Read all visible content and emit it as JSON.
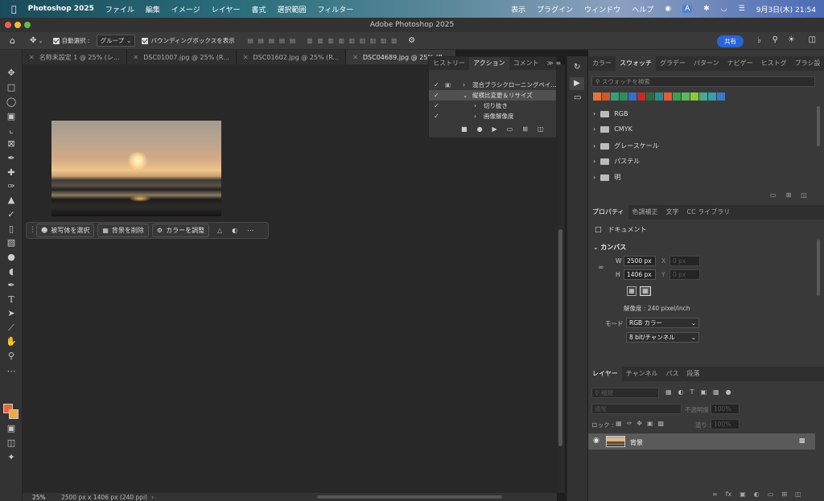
{
  "menubar": {
    "app": "Photoshop 2025",
    "items": [
      "ファイル",
      "編集",
      "イメージ",
      "レイヤー",
      "書式",
      "選択範囲",
      "フィルター"
    ],
    "right_items": [
      "表示",
      "プラグイン",
      "ウィンドウ",
      "ヘルプ"
    ],
    "input_indicator": "A",
    "clock": "9月3日(木) 21:54"
  },
  "window_title": "Adobe Photoshop 2025",
  "options": {
    "auto_select_label": "自動選択 :",
    "auto_select_value": "グループ",
    "bounding_label": "バウンディングボックスを表示",
    "share": "共有"
  },
  "tabs": [
    "名称未設定 1 @ 25% (レ...",
    "DSC01007.jpg @ 25% (R...",
    "DSC01602.jpg @ 25% (R...",
    "DSC04689.jpg @ 25% (R..."
  ],
  "contextbar": {
    "select_subject": "被写体を選択",
    "remove_bg": "背景を削除",
    "adjust_color": "カラーを調整"
  },
  "actions_panel": {
    "tabs": [
      "ヒストリー",
      "アクション",
      "コメント"
    ],
    "rows": [
      "混合ブラシクローニングペイ...",
      "縦横比変更＆リサイズ",
      "切り抜き",
      "画像解像度"
    ]
  },
  "color_panel": {
    "tabs": [
      "カラー",
      "スウォッチ",
      "グラデー",
      "パターン",
      "ナビゲー",
      "ヒストグ",
      "ブラシ設"
    ],
    "search_placeholder": "スウォッチを検索",
    "swatches": [
      "#e8743a",
      "#c85a2a",
      "#3a9a7a",
      "#2e8c5c",
      "#3a6fc8",
      "#c82828",
      "#2e6a3a",
      "#2a8c8c",
      "#e85838",
      "#3aa050",
      "#5cb85c",
      "#8cc83c",
      "#4caa8c",
      "#3a9ab0",
      "#3a78c8"
    ],
    "groups": [
      "RGB",
      "CMYK",
      "グレースケール",
      "パステル",
      "明"
    ]
  },
  "properties_panel": {
    "tabs": [
      "プロパティ",
      "色調補正",
      "文字",
      "CC ライブラリ"
    ],
    "doc_label": "ドキュメント",
    "canvas_label": "カンバス",
    "w_label": "W",
    "w_value": "2500 px",
    "x_label": "X",
    "x_value": "0 px",
    "h_label": "H",
    "h_value": "1406 px",
    "y_label": "Y",
    "y_value": "0 px",
    "resolution": "解像度 : 240 pixel/inch",
    "mode_label": "モード",
    "mode_value": "RGB カラー",
    "depth_value": "8 bit/チャンネル"
  },
  "layers_panel": {
    "tabs": [
      "レイヤー",
      "チャンネル",
      "パス",
      "段落"
    ],
    "filter_placeholder": "種類",
    "blend_mode": "通常",
    "opacity_label": "不透明度 :",
    "opacity_value": "100%",
    "lock_label": "ロック :",
    "fill_label": "塗り :",
    "fill_value": "100%",
    "layer_name": "背景"
  },
  "status": {
    "zoom": "25%",
    "info": "2500 px x 1406 px (240 ppi)"
  }
}
